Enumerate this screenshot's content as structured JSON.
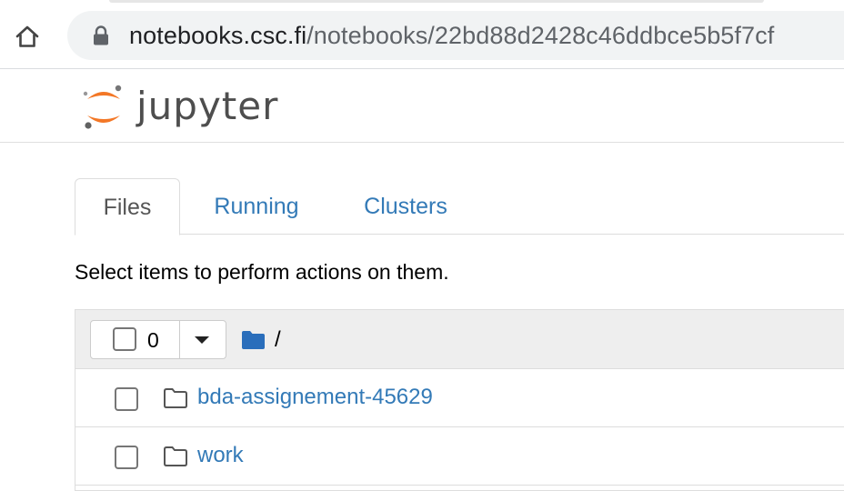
{
  "browser": {
    "url_host": "notebooks.csc.fi",
    "url_path": "/notebooks/22bd88d2428c46ddbce5b5f7cf",
    "home_icon": "home-icon",
    "lock_icon": "lock-icon"
  },
  "header": {
    "logo_text": "jupyter",
    "logo_icon": "jupyter-logo-icon",
    "brand_color": "#f37726"
  },
  "tabs": [
    {
      "label": "Files",
      "active": true
    },
    {
      "label": "Running",
      "active": false
    },
    {
      "label": "Clusters",
      "active": false
    }
  ],
  "instructions": "Select items to perform actions on them.",
  "toolbar": {
    "selected_count": "0",
    "breadcrumb_separator": "/",
    "folder_icon": "folder-icon"
  },
  "files": [
    {
      "name": "bda-assignement-45629",
      "type": "folder"
    },
    {
      "name": "work",
      "type": "folder"
    }
  ],
  "colors": {
    "link": "#337ab7",
    "folder_icon_blue": "#2a6ebb"
  }
}
